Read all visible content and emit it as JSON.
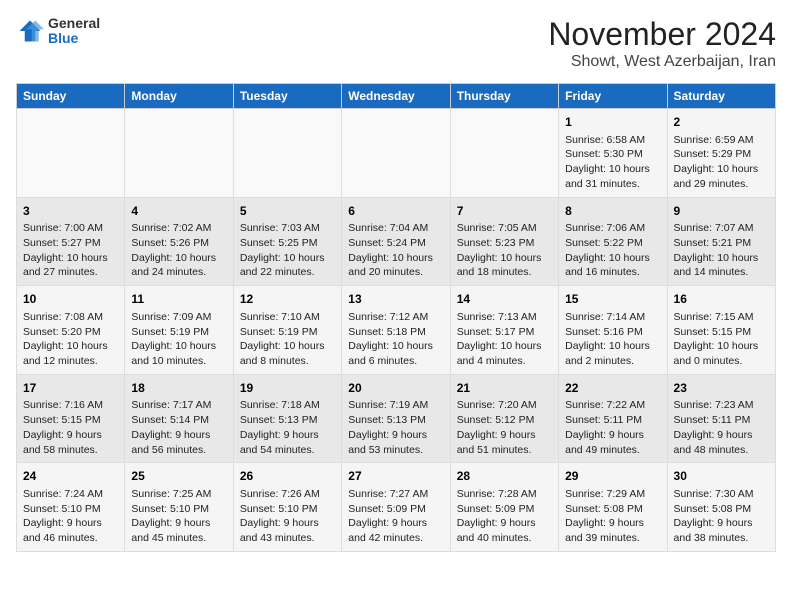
{
  "header": {
    "logo_general": "General",
    "logo_blue": "Blue",
    "month_title": "November 2024",
    "location": "Showt, West Azerbaijan, Iran"
  },
  "weekdays": [
    "Sunday",
    "Monday",
    "Tuesday",
    "Wednesday",
    "Thursday",
    "Friday",
    "Saturday"
  ],
  "weeks": [
    [
      {
        "day": "",
        "info": ""
      },
      {
        "day": "",
        "info": ""
      },
      {
        "day": "",
        "info": ""
      },
      {
        "day": "",
        "info": ""
      },
      {
        "day": "",
        "info": ""
      },
      {
        "day": "1",
        "info": "Sunrise: 6:58 AM\nSunset: 5:30 PM\nDaylight: 10 hours and 31 minutes."
      },
      {
        "day": "2",
        "info": "Sunrise: 6:59 AM\nSunset: 5:29 PM\nDaylight: 10 hours and 29 minutes."
      }
    ],
    [
      {
        "day": "3",
        "info": "Sunrise: 7:00 AM\nSunset: 5:27 PM\nDaylight: 10 hours and 27 minutes."
      },
      {
        "day": "4",
        "info": "Sunrise: 7:02 AM\nSunset: 5:26 PM\nDaylight: 10 hours and 24 minutes."
      },
      {
        "day": "5",
        "info": "Sunrise: 7:03 AM\nSunset: 5:25 PM\nDaylight: 10 hours and 22 minutes."
      },
      {
        "day": "6",
        "info": "Sunrise: 7:04 AM\nSunset: 5:24 PM\nDaylight: 10 hours and 20 minutes."
      },
      {
        "day": "7",
        "info": "Sunrise: 7:05 AM\nSunset: 5:23 PM\nDaylight: 10 hours and 18 minutes."
      },
      {
        "day": "8",
        "info": "Sunrise: 7:06 AM\nSunset: 5:22 PM\nDaylight: 10 hours and 16 minutes."
      },
      {
        "day": "9",
        "info": "Sunrise: 7:07 AM\nSunset: 5:21 PM\nDaylight: 10 hours and 14 minutes."
      }
    ],
    [
      {
        "day": "10",
        "info": "Sunrise: 7:08 AM\nSunset: 5:20 PM\nDaylight: 10 hours and 12 minutes."
      },
      {
        "day": "11",
        "info": "Sunrise: 7:09 AM\nSunset: 5:19 PM\nDaylight: 10 hours and 10 minutes."
      },
      {
        "day": "12",
        "info": "Sunrise: 7:10 AM\nSunset: 5:19 PM\nDaylight: 10 hours and 8 minutes."
      },
      {
        "day": "13",
        "info": "Sunrise: 7:12 AM\nSunset: 5:18 PM\nDaylight: 10 hours and 6 minutes."
      },
      {
        "day": "14",
        "info": "Sunrise: 7:13 AM\nSunset: 5:17 PM\nDaylight: 10 hours and 4 minutes."
      },
      {
        "day": "15",
        "info": "Sunrise: 7:14 AM\nSunset: 5:16 PM\nDaylight: 10 hours and 2 minutes."
      },
      {
        "day": "16",
        "info": "Sunrise: 7:15 AM\nSunset: 5:15 PM\nDaylight: 10 hours and 0 minutes."
      }
    ],
    [
      {
        "day": "17",
        "info": "Sunrise: 7:16 AM\nSunset: 5:15 PM\nDaylight: 9 hours and 58 minutes."
      },
      {
        "day": "18",
        "info": "Sunrise: 7:17 AM\nSunset: 5:14 PM\nDaylight: 9 hours and 56 minutes."
      },
      {
        "day": "19",
        "info": "Sunrise: 7:18 AM\nSunset: 5:13 PM\nDaylight: 9 hours and 54 minutes."
      },
      {
        "day": "20",
        "info": "Sunrise: 7:19 AM\nSunset: 5:13 PM\nDaylight: 9 hours and 53 minutes."
      },
      {
        "day": "21",
        "info": "Sunrise: 7:20 AM\nSunset: 5:12 PM\nDaylight: 9 hours and 51 minutes."
      },
      {
        "day": "22",
        "info": "Sunrise: 7:22 AM\nSunset: 5:11 PM\nDaylight: 9 hours and 49 minutes."
      },
      {
        "day": "23",
        "info": "Sunrise: 7:23 AM\nSunset: 5:11 PM\nDaylight: 9 hours and 48 minutes."
      }
    ],
    [
      {
        "day": "24",
        "info": "Sunrise: 7:24 AM\nSunset: 5:10 PM\nDaylight: 9 hours and 46 minutes."
      },
      {
        "day": "25",
        "info": "Sunrise: 7:25 AM\nSunset: 5:10 PM\nDaylight: 9 hours and 45 minutes."
      },
      {
        "day": "26",
        "info": "Sunrise: 7:26 AM\nSunset: 5:10 PM\nDaylight: 9 hours and 43 minutes."
      },
      {
        "day": "27",
        "info": "Sunrise: 7:27 AM\nSunset: 5:09 PM\nDaylight: 9 hours and 42 minutes."
      },
      {
        "day": "28",
        "info": "Sunrise: 7:28 AM\nSunset: 5:09 PM\nDaylight: 9 hours and 40 minutes."
      },
      {
        "day": "29",
        "info": "Sunrise: 7:29 AM\nSunset: 5:08 PM\nDaylight: 9 hours and 39 minutes."
      },
      {
        "day": "30",
        "info": "Sunrise: 7:30 AM\nSunset: 5:08 PM\nDaylight: 9 hours and 38 minutes."
      }
    ]
  ]
}
